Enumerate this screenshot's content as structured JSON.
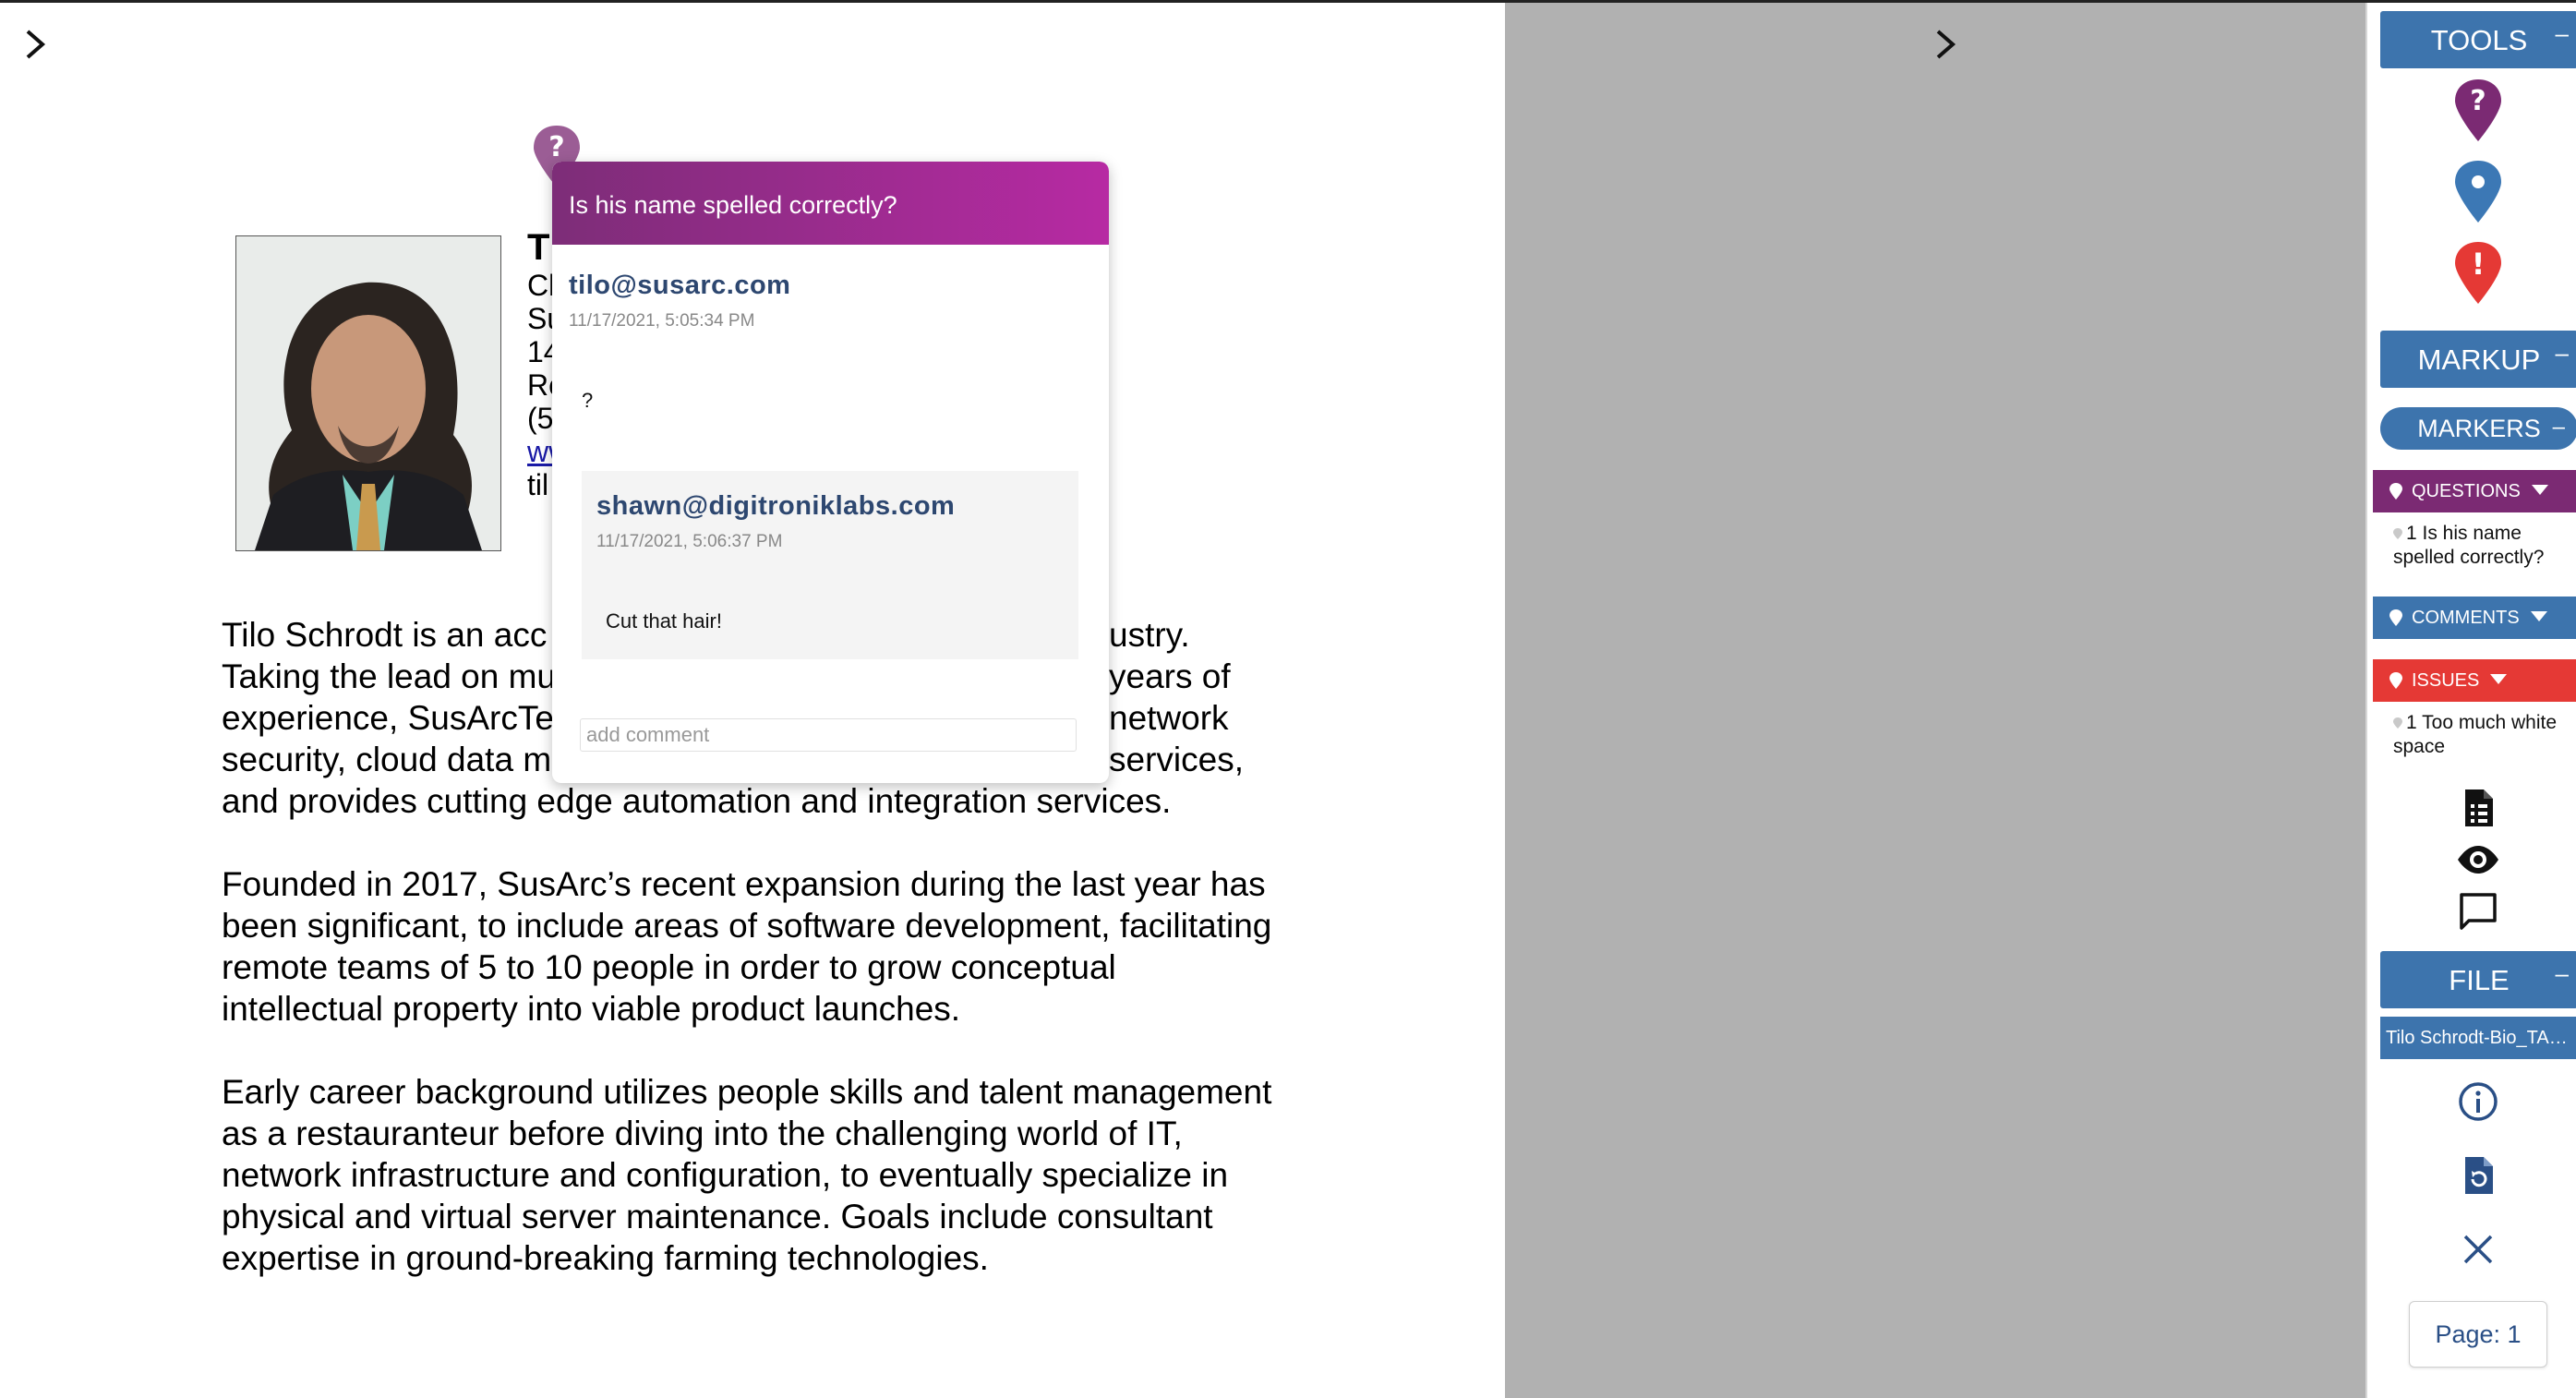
{
  "document": {
    "name_initial": "T",
    "info_line_fragments": [
      "Cl",
      "Su",
      "14",
      "Ro",
      "(5",
      "ww",
      "til"
    ],
    "paragraphs": [
      {
        "left_lines": [
          "Tilo Schrodt is an acc",
          "Taking the lead on mu",
          "experience, SusArcTe",
          "security, cloud data m",
          "and provides cutting edge automation and integration services."
        ],
        "right_lines": [
          "ustry.",
          "years of",
          "network",
          "services,",
          ""
        ]
      },
      {
        "lines": [
          "Founded in 2017, SusArc’s recent expansion during the last year has",
          "been significant, to include areas of software development, facilitating",
          "remote teams of 5 to 10 people in order to grow conceptual",
          "intellectual property into viable product launches."
        ]
      },
      {
        "lines": [
          "Early career background utilizes people skills and talent management",
          "as a restauranteur before diving into the challenging world of IT,",
          "network infrastructure and configuration, to eventually specialize in",
          "physical and virtual server maintenance. Goals include consultant",
          "expertise in ground-breaking farming technologies."
        ]
      }
    ]
  },
  "popup": {
    "pin_glyph": "?",
    "title": "Is his name spelled correctly?",
    "comments": [
      {
        "author": "tilo@susarc.com",
        "time": "11/17/2021, 5:05:34 PM",
        "text": "?"
      },
      {
        "author": "shawn@digitroniklabs.com",
        "time": "11/17/2021, 5:06:37 PM",
        "text": "Cut that hair!"
      }
    ],
    "add_comment_placeholder": "add comment"
  },
  "sidebar": {
    "tools": {
      "label": "TOOLS",
      "minus": "–"
    },
    "tool_pins": [
      {
        "icon": "question-pin-icon",
        "glyph": "?",
        "color": "#7b2a73"
      },
      {
        "icon": "location-pin-icon",
        "glyph": "",
        "color": "#3c78b5"
      },
      {
        "icon": "issue-pin-icon",
        "glyph": "!",
        "color": "#e53935"
      }
    ],
    "markup": {
      "label": "MARKUP",
      "minus": "–"
    },
    "markers": {
      "label": "MARKERS",
      "minus": "–"
    },
    "categories": {
      "questions": {
        "label": "QUESTIONS",
        "color": "#7b2a73",
        "item_lines": [
          "1 Is his name",
          "spelled correctly?"
        ]
      },
      "comments": {
        "label": "COMMENTS",
        "color": "#3d74ad"
      },
      "issues": {
        "label": "ISSUES",
        "color": "#e53935",
        "item_lines": [
          "1 Too much white",
          "space"
        ]
      }
    },
    "file": {
      "label": "FILE",
      "minus": "–",
      "file_name": "Tilo Schrodt-Bio_TAB...."
    },
    "page": {
      "label": "Page: 1"
    }
  },
  "colors": {
    "accent_blue": "#3d74ad",
    "question_purple": "#7b2a73",
    "issue_red": "#e53935",
    "viewer_gray": "#b1b1b1"
  }
}
